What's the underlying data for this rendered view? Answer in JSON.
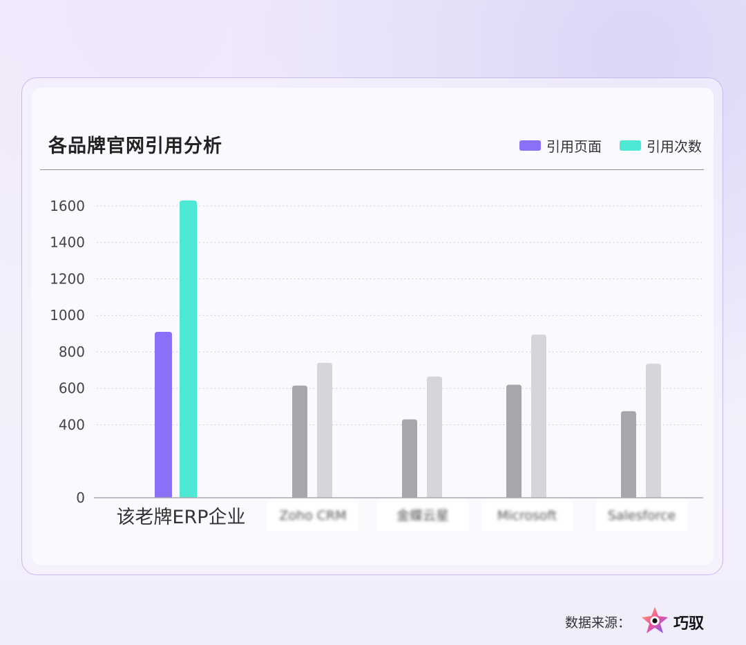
{
  "title": "各品牌官网引用分析",
  "legend": [
    {
      "label": "引用页面",
      "color": "#8a6ff7"
    },
    {
      "label": "引用次数",
      "color": "#4ee9d4"
    }
  ],
  "chart_data": {
    "type": "bar",
    "title": "各品牌官网引用分析",
    "categories": [
      "该老牌ERP企业",
      "Zoho CRM",
      "金蝶云星",
      "Microsoft",
      "Salesforce"
    ],
    "series": [
      {
        "name": "引用页面",
        "values": [
          910,
          615,
          430,
          620,
          475
        ]
      },
      {
        "name": "引用次数",
        "values": [
          1630,
          740,
          665,
          895,
          735
        ]
      }
    ],
    "highlight_index": 0,
    "muted_colors": [
      "#a7a7ab",
      "#d6d5da"
    ],
    "yticks": [
      0,
      400,
      600,
      800,
      1000,
      1200,
      1400,
      1600
    ],
    "ylim": [
      0,
      1600
    ],
    "grid": true,
    "legend_position": "top-right"
  },
  "footer": {
    "source_label": "数据来源：",
    "brand_name": "巧驭",
    "brand_icon": "brand-star-icon"
  }
}
